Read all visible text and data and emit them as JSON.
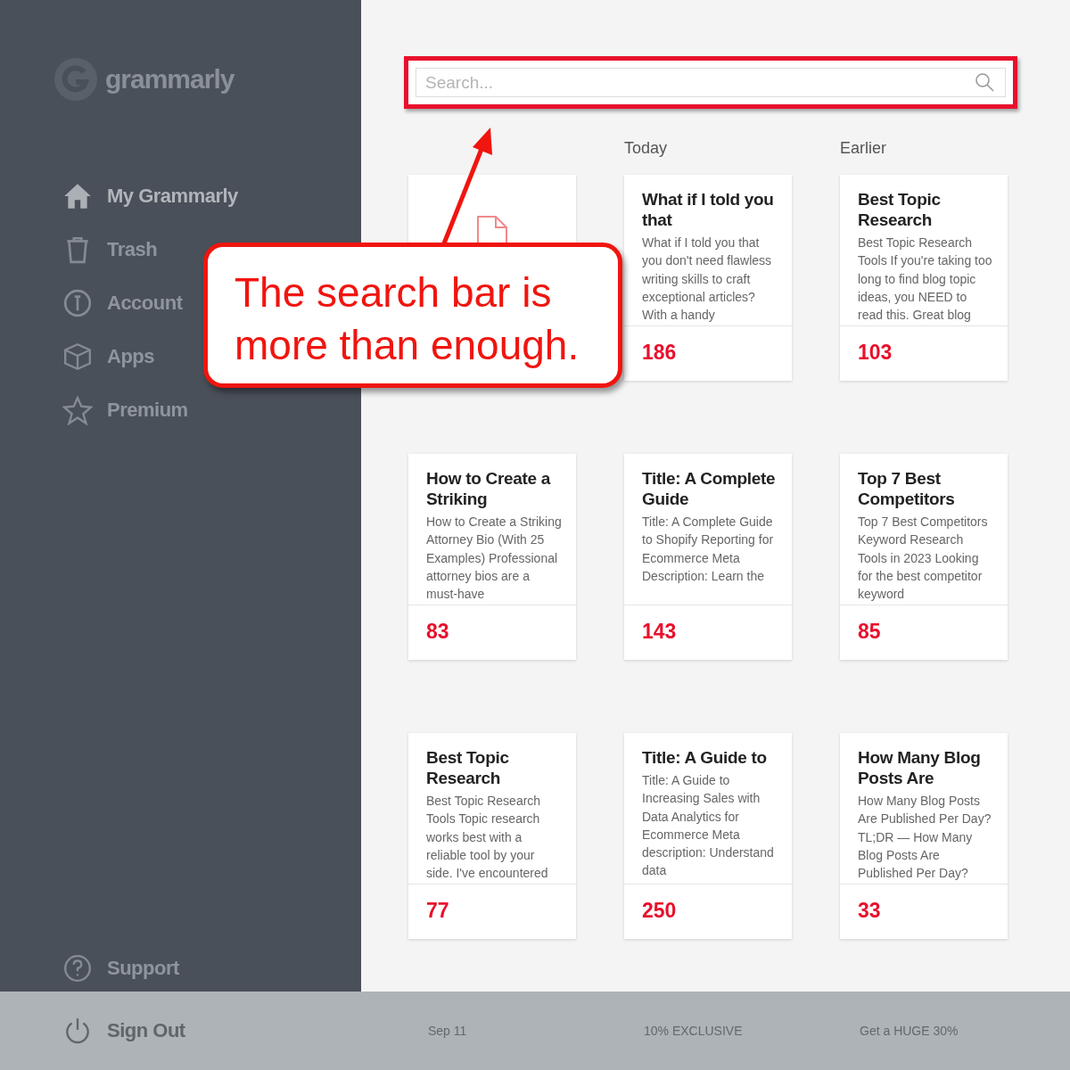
{
  "sidebar": {
    "logo": "grammarly",
    "items": [
      {
        "label": "My Grammarly",
        "selected": true
      },
      {
        "label": "Trash",
        "selected": false
      },
      {
        "label": "Account",
        "selected": false
      },
      {
        "label": "Apps",
        "selected": false
      },
      {
        "label": "Premium",
        "selected": false
      }
    ],
    "bottom_items": [
      {
        "label": "Support"
      },
      {
        "label": "Sign Out"
      }
    ]
  },
  "search": {
    "placeholder": "Search...",
    "highlighted": true
  },
  "column_headers": [
    {
      "label": "Today"
    },
    {
      "label": "Earlier"
    }
  ],
  "cards": [
    {
      "kind": "new"
    },
    {
      "kind": "document",
      "title": "What if I told you that",
      "excerpt": "What if I told you that you don't need flawless writing skills to craft exceptional articles? With a handy",
      "count": "186"
    },
    {
      "kind": "document",
      "title": "Best Topic Research",
      "excerpt": "Best Topic Research Tools If you're taking too long to find blog topic ideas, you NEED to read this. Great blog",
      "count": "103"
    },
    {
      "kind": "document",
      "title": "How to Create a Striking",
      "excerpt": "How to Create a Striking Attorney Bio (With 25 Examples) Professional attorney bios are a must-have",
      "count": "83"
    },
    {
      "kind": "document",
      "title": "Title: A Complete Guide",
      "excerpt": "Title: A Complete Guide to Shopify Reporting for Ecommerce Meta Description: Learn the",
      "count": "143"
    },
    {
      "kind": "document",
      "title": "Top 7 Best Competitors",
      "excerpt": "Top 7 Best Competitors Keyword Research Tools in 2023 Looking for the best competitor keyword",
      "count": "85"
    },
    {
      "kind": "document",
      "title": "Best Topic Research",
      "excerpt": "Best Topic Research Tools Topic research works best with a reliable tool by your side. I've encountered",
      "count": "77"
    },
    {
      "kind": "document",
      "title": "Title: A Guide to",
      "excerpt": "Title: A Guide to Increasing Sales with Data Analytics for Ecommerce Meta description: Understand data",
      "count": "250"
    },
    {
      "kind": "document",
      "title": "How Many Blog Posts Are",
      "excerpt": "How Many Blog Posts Are Published Per Day? TL;DR — How Many Blog Posts Are Published Per Day?",
      "count": "33"
    }
  ],
  "callout": {
    "text": "The search bar is more than enough."
  },
  "bottom_bar": [
    "Sep 11",
    "10% EXCLUSIVE",
    "Get a HUGE 30%"
  ]
}
